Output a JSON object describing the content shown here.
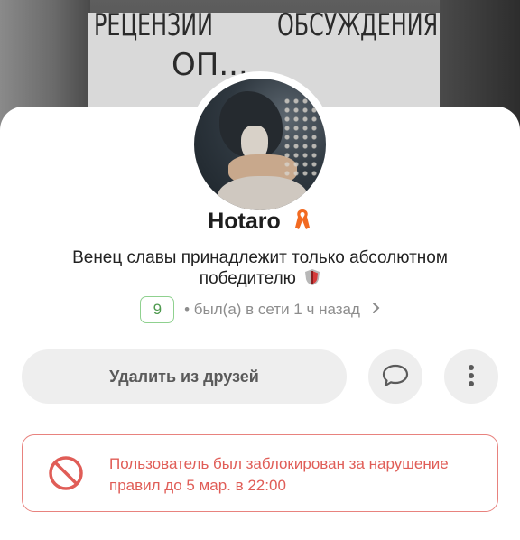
{
  "cover": {
    "word_left": "РЕЦЕНЗИИ",
    "word_right": "ОБСУЖДЕНИЯ",
    "word_bottom": "ОП..."
  },
  "profile": {
    "name": "Hotaro",
    "name_badge_icon": "orange-ribbon-icon",
    "bio": "Венец славы принадлежит только абсолютном победителю",
    "bio_icon": "shield-icon",
    "level": "9",
    "status": "• был(а) в сети 1 ч назад",
    "level_color": "#8fd18f",
    "status_chevron_icon": "chevron-right-icon"
  },
  "actions": {
    "remove_friend_label": "Удалить из друзей",
    "message_icon": "chat-bubble-icon",
    "more_icon": "vertical-dots-icon"
  },
  "notice": {
    "icon": "blocked-circle-icon",
    "text": "Пользователь был заблокирован за нарушение правил до 5 мар. в 22:00",
    "color": "#e05d57"
  }
}
